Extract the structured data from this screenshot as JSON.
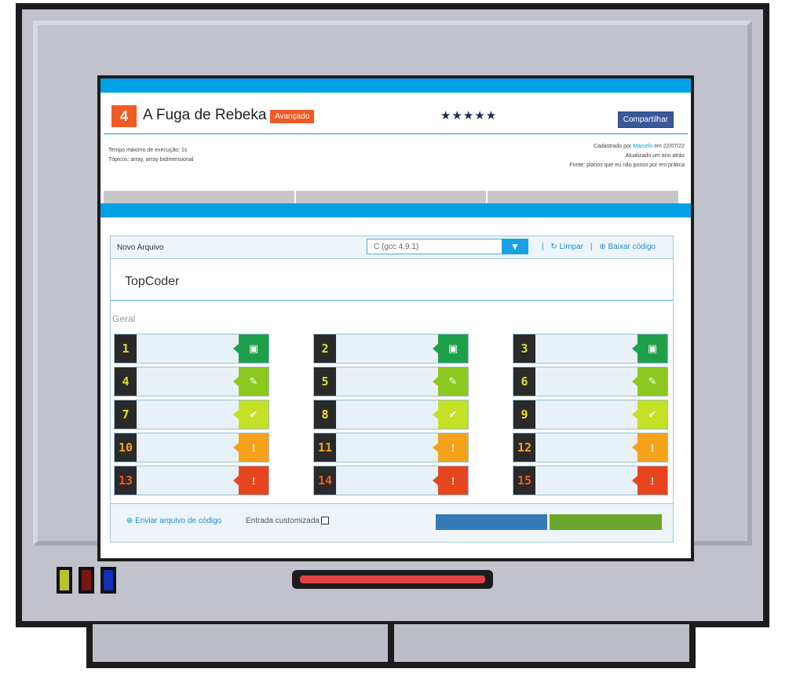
{
  "problem": {
    "number": "4",
    "title": "A Fuga de Rebeka",
    "level": "Avançado",
    "rating": "★★★★★",
    "share_label": "Compartilhar"
  },
  "meta": {
    "left": [
      "Tempo máximo de execução: 1s",
      "Tópicos: array, array bidimensional"
    ],
    "right_line1_prefix": "Cadastrado por ",
    "right_line1_link": "Marcelo",
    "right_line1_suffix": " em 22/07/22",
    "right_line2": "Atualizado um ano atrás",
    "right_line3": "Fonte: planos que eu não posso por em prática"
  },
  "editor": {
    "file_label": "Novo Arquivo",
    "language": "C (gcc 4.9.1)",
    "clear_label": "Limpar",
    "download_label": "Baixar código",
    "code_text": "TopCoder",
    "section_label": "Geral",
    "send_label": "Enviar arquivo de código",
    "custom_input_label": "Entrada customizada"
  },
  "colors": {
    "accent": "#00a0e6",
    "orange": "#f05a23",
    "share": "#3b5998",
    "status_green_dark": "#1ea04a",
    "status_green_light": "#8cc820",
    "status_yellow_green": "#c6e025",
    "status_orange": "#f7a11a",
    "status_red": "#e8451f"
  },
  "test_cases": [
    {
      "num": "1",
      "status": "badge-icon",
      "row": 0,
      "col": 0
    },
    {
      "num": "2",
      "status": "badge-icon",
      "row": 0,
      "col": 1
    },
    {
      "num": "3",
      "status": "badge-icon",
      "row": 0,
      "col": 2
    },
    {
      "num": "4",
      "status": "clipboard-check-icon",
      "row": 1,
      "col": 0
    },
    {
      "num": "5",
      "status": "clipboard-check-icon",
      "row": 1,
      "col": 1
    },
    {
      "num": "6",
      "status": "clipboard-check-icon",
      "row": 1,
      "col": 2
    },
    {
      "num": "7",
      "status": "checkmark-icon",
      "row": 2,
      "col": 0
    },
    {
      "num": "8",
      "status": "checkmark-icon",
      "row": 2,
      "col": 1
    },
    {
      "num": "9",
      "status": "checkmark-icon",
      "row": 2,
      "col": 2
    },
    {
      "num": "10",
      "status": "warning-icon",
      "row": 3,
      "col": 0
    },
    {
      "num": "11",
      "status": "warning-icon",
      "row": 3,
      "col": 1
    },
    {
      "num": "12",
      "status": "warning-icon",
      "row": 3,
      "col": 2
    },
    {
      "num": "13",
      "status": "error-icon",
      "row": 4,
      "col": 0
    },
    {
      "num": "14",
      "status": "error-icon",
      "row": 4,
      "col": 1
    },
    {
      "num": "15",
      "status": "error-icon",
      "row": 4,
      "col": 2
    }
  ]
}
